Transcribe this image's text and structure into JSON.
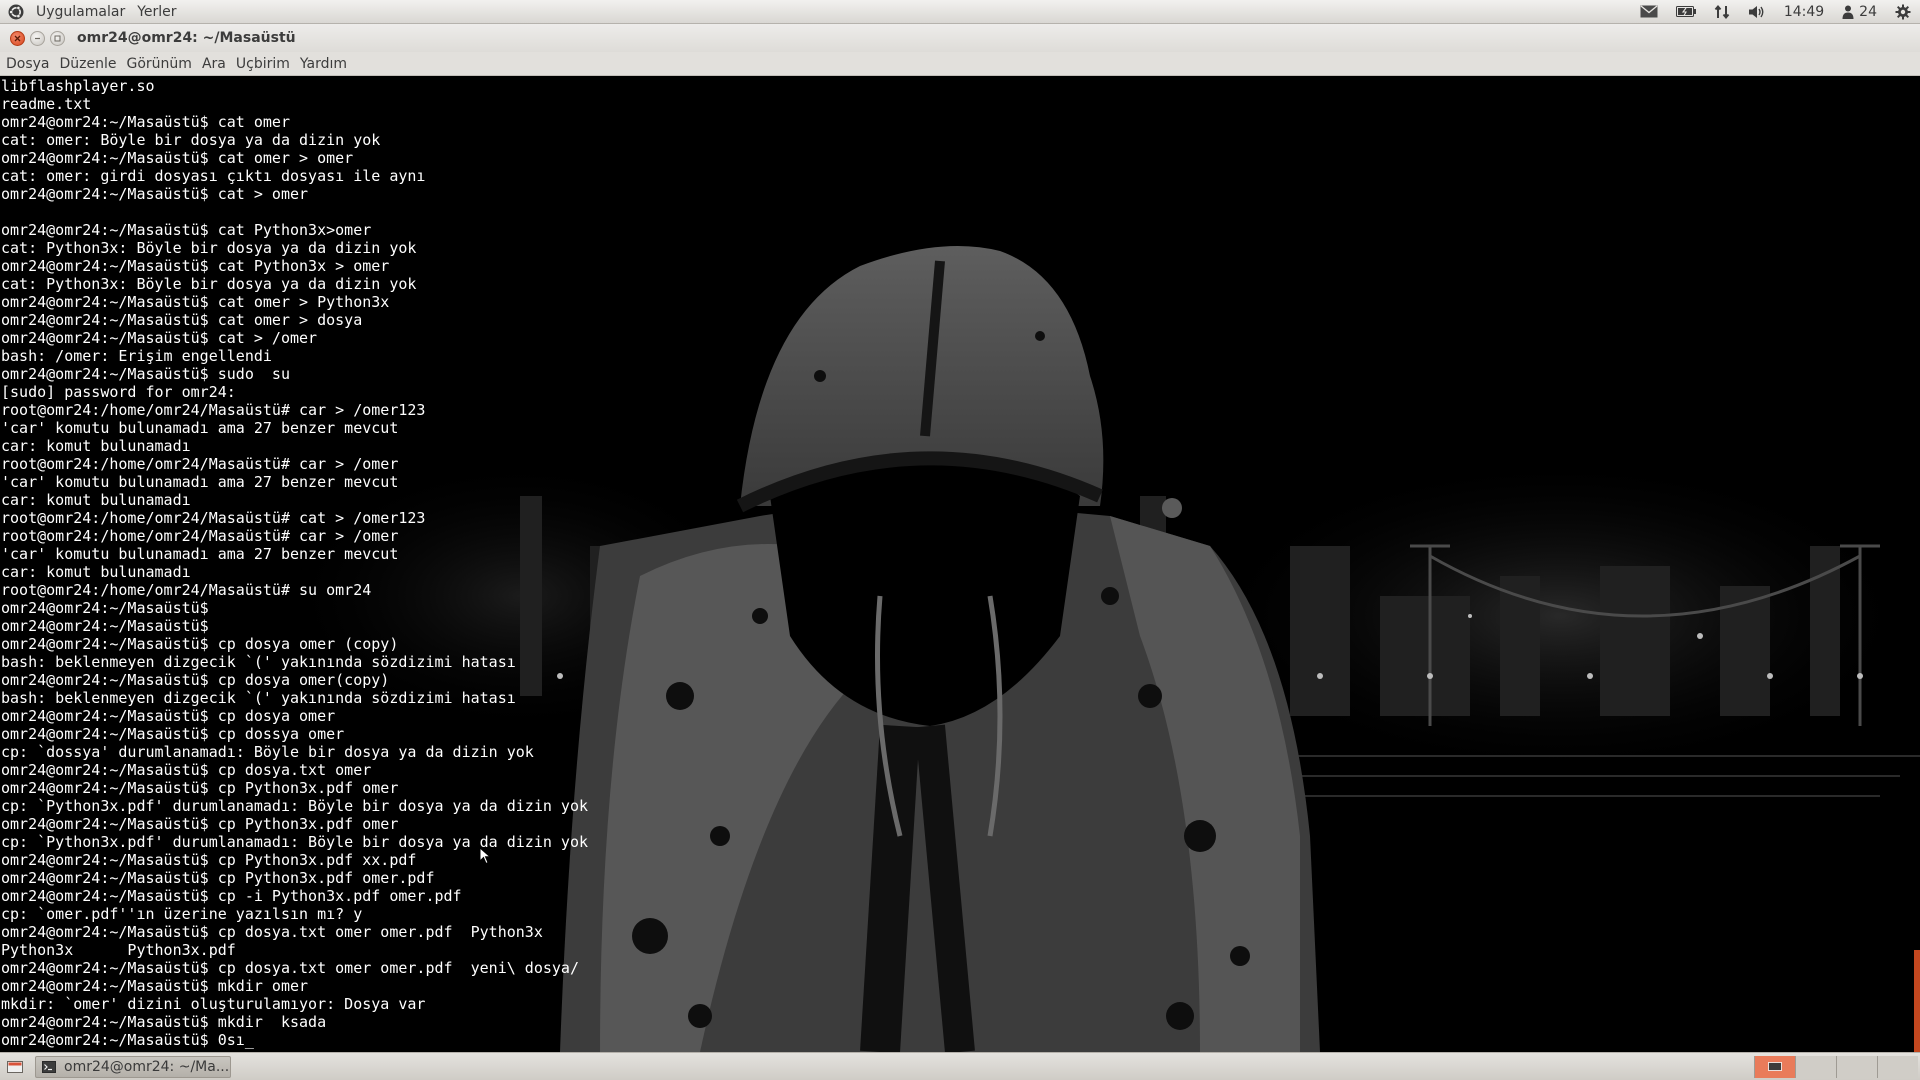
{
  "top_panel": {
    "logo_icon": "ubuntu-logo-icon",
    "menus": [
      "Uygulamalar",
      "Yerler"
    ],
    "indicators": [
      "mail-icon",
      "battery-icon",
      "network-icon",
      "volume-icon"
    ],
    "clock": "14:49",
    "user_count": "24",
    "power_icon": "gear-icon"
  },
  "window": {
    "title": "omr24@omr24: ~/Masaüstü",
    "menu": [
      "Dosya",
      "Düzenle",
      "Görünüm",
      "Ara",
      "Uçbirim",
      "Yardım"
    ]
  },
  "terminal": {
    "lines": [
      "libflashplayer.so",
      "readme.txt",
      "omr24@omr24:~/Masaüstü$ cat omer",
      "cat: omer: Böyle bir dosya ya da dizin yok",
      "omr24@omr24:~/Masaüstü$ cat omer > omer",
      "cat: omer: girdi dosyası çıktı dosyası ile aynı",
      "omr24@omr24:~/Masaüstü$ cat > omer",
      "",
      "omr24@omr24:~/Masaüstü$ cat Python3x>omer",
      "cat: Python3x: Böyle bir dosya ya da dizin yok",
      "omr24@omr24:~/Masaüstü$ cat Python3x > omer",
      "cat: Python3x: Böyle bir dosya ya da dizin yok",
      "omr24@omr24:~/Masaüstü$ cat omer > Python3x",
      "omr24@omr24:~/Masaüstü$ cat omer > dosya",
      "omr24@omr24:~/Masaüstü$ cat > /omer",
      "bash: /omer: Erişim engellendi",
      "omr24@omr24:~/Masaüstü$ sudo  su",
      "[sudo] password for omr24:",
      "root@omr24:/home/omr24/Masaüstü# car > /omer123",
      "'car' komutu bulunamadı ama 27 benzer mevcut",
      "car: komut bulunamadı",
      "root@omr24:/home/omr24/Masaüstü# car > /omer",
      "'car' komutu bulunamadı ama 27 benzer mevcut",
      "car: komut bulunamadı",
      "root@omr24:/home/omr24/Masaüstü# cat > /omer123",
      "root@omr24:/home/omr24/Masaüstü# car > /omer",
      "'car' komutu bulunamadı ama 27 benzer mevcut",
      "car: komut bulunamadı",
      "root@omr24:/home/omr24/Masaüstü# su omr24",
      "omr24@omr24:~/Masaüstü$",
      "omr24@omr24:~/Masaüstü$",
      "omr24@omr24:~/Masaüstü$ cp dosya omer (copy)",
      "bash: beklenmeyen dizgecik `(' yakınında sözdizimi hatası",
      "omr24@omr24:~/Masaüstü$ cp dosya omer(copy)",
      "bash: beklenmeyen dizgecik `(' yakınında sözdizimi hatası",
      "omr24@omr24:~/Masaüstü$ cp dosya omer",
      "omr24@omr24:~/Masaüstü$ cp dossya omer",
      "cp: `dossya' durumlanamadı: Böyle bir dosya ya da dizin yok",
      "omr24@omr24:~/Masaüstü$ cp dosya.txt omer",
      "omr24@omr24:~/Masaüstü$ cp Python3x.pdf omer",
      "cp: `Python3x.pdf' durumlanamadı: Böyle bir dosya ya da dizin yok",
      "omr24@omr24:~/Masaüstü$ cp Python3x.pdf omer",
      "cp: `Python3x.pdf' durumlanamadı: Böyle bir dosya ya da dizin yok",
      "omr24@omr24:~/Masaüstü$ cp Python3x.pdf xx.pdf",
      "omr24@omr24:~/Masaüstü$ cp Python3x.pdf omer.pdf",
      "omr24@omr24:~/Masaüstü$ cp -i Python3x.pdf omer.pdf",
      "cp: `omer.pdf''ın üzerine yazılsın mı? y",
      "omr24@omr24:~/Masaüstü$ cp dosya.txt omer omer.pdf  Python3x",
      "Python3x      Python3x.pdf",
      "omr24@omr24:~/Masaüstü$ cp dosya.txt omer omer.pdf  yeni\\ dosya/",
      "omr24@omr24:~/Masaüstü$ mkdir omer",
      "mkdir: `omer' dizini oluşturulamıyor: Dosya var",
      "omr24@omr24:~/Masaüstü$ mkdir  ksada",
      "omr24@omr24:~/Masaüstü$ 0sı"
    ],
    "cursor": "_",
    "wallpaper": "hooded-figure-city-night"
  },
  "taskbar": {
    "show_desktop_icon": "show-desktop-icon",
    "task_label": "omr24@omr24: ~/Ma...",
    "task_icon": "terminal-icon"
  },
  "colors": {
    "panel": "#dedcd8",
    "terminal_bg": "#000000",
    "terminal_fg": "#ffffff",
    "accent": "#e97b5a"
  }
}
